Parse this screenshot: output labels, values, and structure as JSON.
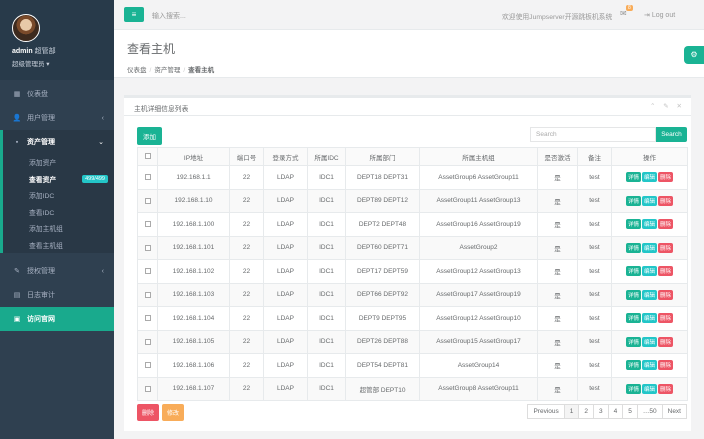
{
  "profile": {
    "name": "admin",
    "role_inline": "超管部",
    "role": "超级管理员 ▾"
  },
  "sidebar": {
    "items": [
      {
        "icon": "▦",
        "label": "仪表盘"
      },
      {
        "icon": "👤",
        "label": "用户管理",
        "chev": "‹"
      },
      {
        "icon": "▪",
        "label": "资产管理",
        "chev": "⌄"
      },
      {
        "icon": "✎",
        "label": "授权管理",
        "chev": "‹"
      },
      {
        "icon": "▤",
        "label": "日志审计"
      },
      {
        "icon": "▣",
        "label": "访问官网"
      }
    ],
    "sub": [
      "添加资产",
      "查看资产",
      "添加IDC",
      "查看IDC",
      "添加主机组",
      "查看主机组"
    ],
    "badge": "499/499"
  },
  "topbar": {
    "toggle": "≡",
    "search_placeholder": "输入搜索...",
    "welcome": "欢迎使用Jumpserver开源跳板机系统",
    "mail_icon": "✉",
    "mail_count": "8",
    "logout": "Log out"
  },
  "page": {
    "title": "查看主机",
    "breadcrumb": [
      "仪表盘",
      "资产管理",
      "查看主机"
    ]
  },
  "panel": {
    "title": "主机详细信息列表",
    "tools": "⌃ ✎ ✕",
    "add": "添加",
    "search_placeholder": "Search",
    "search": "Search",
    "columns": [
      "",
      "IP地址",
      "端口号",
      "登录方式",
      "所属IDC",
      "所属部门",
      "所属主机组",
      "是否激活",
      "备注",
      "操作"
    ],
    "actions": [
      "详情",
      "编辑",
      "删除"
    ],
    "rows": [
      [
        "192.168.1.1",
        "22",
        "LDAP",
        "IDC1",
        "DEPT18 DEPT31",
        "AssetGroup6 AssetGroup11",
        "是",
        "test"
      ],
      [
        "192.168.1.10",
        "22",
        "LDAP",
        "IDC1",
        "DEPT89 DEPT12",
        "AssetGroup11 AssetGroup13",
        "是",
        "test"
      ],
      [
        "192.168.1.100",
        "22",
        "LDAP",
        "IDC1",
        "DEPT2 DEPT48",
        "AssetGroup16 AssetGroup19",
        "是",
        "test"
      ],
      [
        "192.168.1.101",
        "22",
        "LDAP",
        "IDC1",
        "DEPT60 DEPT71",
        "AssetGroup2",
        "是",
        "test"
      ],
      [
        "192.168.1.102",
        "22",
        "LDAP",
        "IDC1",
        "DEPT17 DEPT59",
        "AssetGroup12 AssetGroup13",
        "是",
        "test"
      ],
      [
        "192.168.1.103",
        "22",
        "LDAP",
        "IDC1",
        "DEPT66 DEPT92",
        "AssetGroup17 AssetGroup19",
        "是",
        "test"
      ],
      [
        "192.168.1.104",
        "22",
        "LDAP",
        "IDC1",
        "DEPT9 DEPT95",
        "AssetGroup12 AssetGroup10",
        "是",
        "test"
      ],
      [
        "192.168.1.105",
        "22",
        "LDAP",
        "IDC1",
        "DEPT26 DEPT88",
        "AssetGroup15 AssetGroup17",
        "是",
        "test"
      ],
      [
        "192.168.1.106",
        "22",
        "LDAP",
        "IDC1",
        "DEPT54 DEPT81",
        "AssetGroup14",
        "是",
        "test"
      ],
      [
        "192.168.1.107",
        "22",
        "LDAP",
        "IDC1",
        "超管部 DEPT10",
        "AssetGroup8 AssetGroup11",
        "是",
        "test"
      ]
    ],
    "delete": "删除",
    "modify": "修改",
    "pager": [
      "Previous",
      "1",
      "2",
      "3",
      "4",
      "5",
      "…50",
      "Next"
    ]
  }
}
